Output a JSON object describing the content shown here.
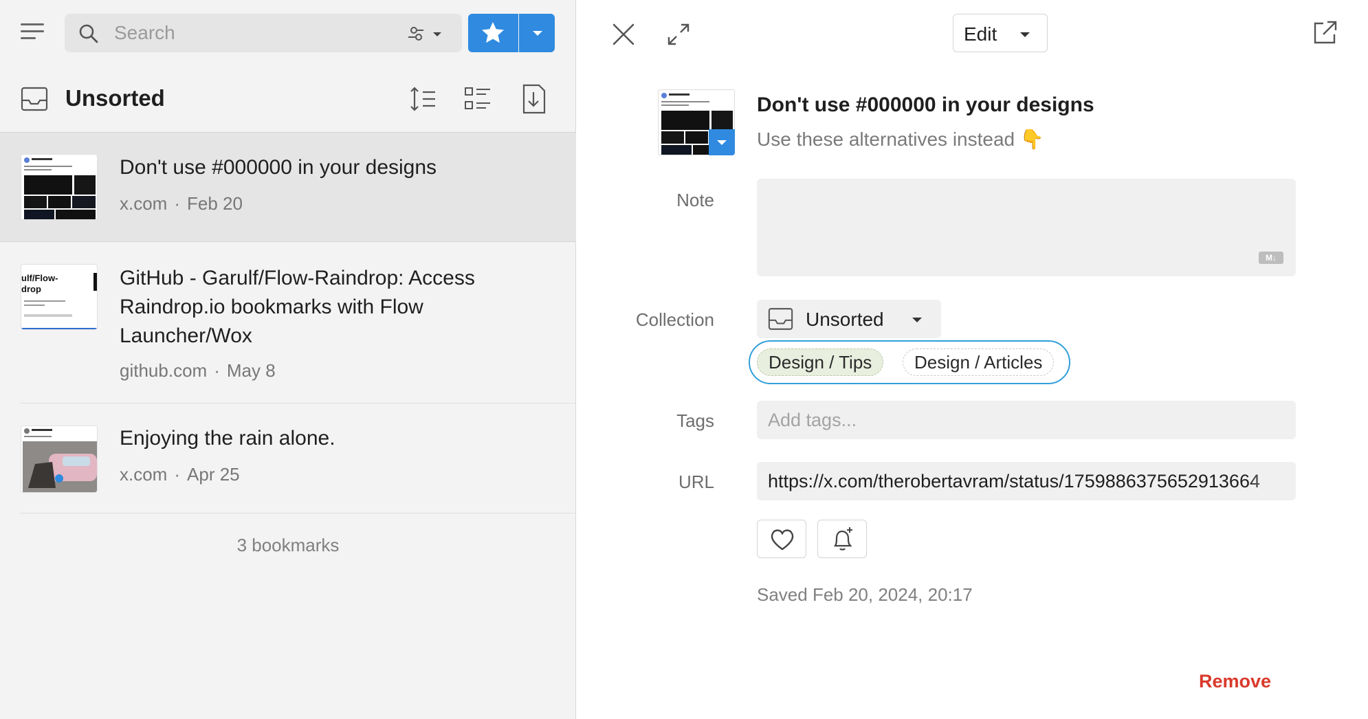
{
  "sidebar": {
    "search": {
      "placeholder": "Search"
    },
    "collection": {
      "title": "Unsorted"
    },
    "items": [
      {
        "title": "Don't use #000000 in your designs",
        "domain": "x.com",
        "separator": "·",
        "date": "Feb 20",
        "selected": true
      },
      {
        "title": "GitHub - Garulf/Flow-Raindrop: Access Raindrop.io bookmarks with Flow Launcher/Wox",
        "domain": "github.com",
        "separator": "·",
        "date": "May 8",
        "selected": false
      },
      {
        "title": "Enjoying the rain alone.",
        "domain": "x.com",
        "separator": "·",
        "date": "Apr 25",
        "selected": false
      }
    ],
    "thumb_texts": {
      "flow": "ulf/Flow-\ndrop"
    },
    "count": "3 bookmarks"
  },
  "detail": {
    "edit_label": "Edit",
    "title": "Don't use #000000 in your designs",
    "excerpt": "Use these alternatives instead 👇",
    "labels": {
      "note": "Note",
      "collection": "Collection",
      "tags": "Tags",
      "url": "URL"
    },
    "note_value": "",
    "md_badge": "M↓",
    "collection_value": "Unsorted",
    "suggested_tags": [
      "Design / Tips",
      "Design / Articles"
    ],
    "tags_placeholder": "Add tags...",
    "url_value": "https://x.com/therobertavram/status/1759886375652913664",
    "saved": "Saved Feb 20, 2024, 20:17",
    "remove_label": "Remove"
  },
  "colors": {
    "accent": "#2f8ae0",
    "suggest_border": "#2f9fd9",
    "remove": "#d93a2b",
    "panel_bg": "#f3f3f3",
    "selected_bg": "#e5e5e5"
  },
  "icons": {
    "menu": "hamburger-icon",
    "search": "search-icon",
    "filter": "filter-icon",
    "star": "star-icon",
    "collection": "inbox-icon",
    "sort": "sort-icon",
    "view": "list-view-icon",
    "download": "download-icon",
    "close": "close-icon",
    "expand": "expand-icon",
    "open": "external-link-icon",
    "heart": "heart-icon",
    "reminder": "bell-plus-icon"
  }
}
